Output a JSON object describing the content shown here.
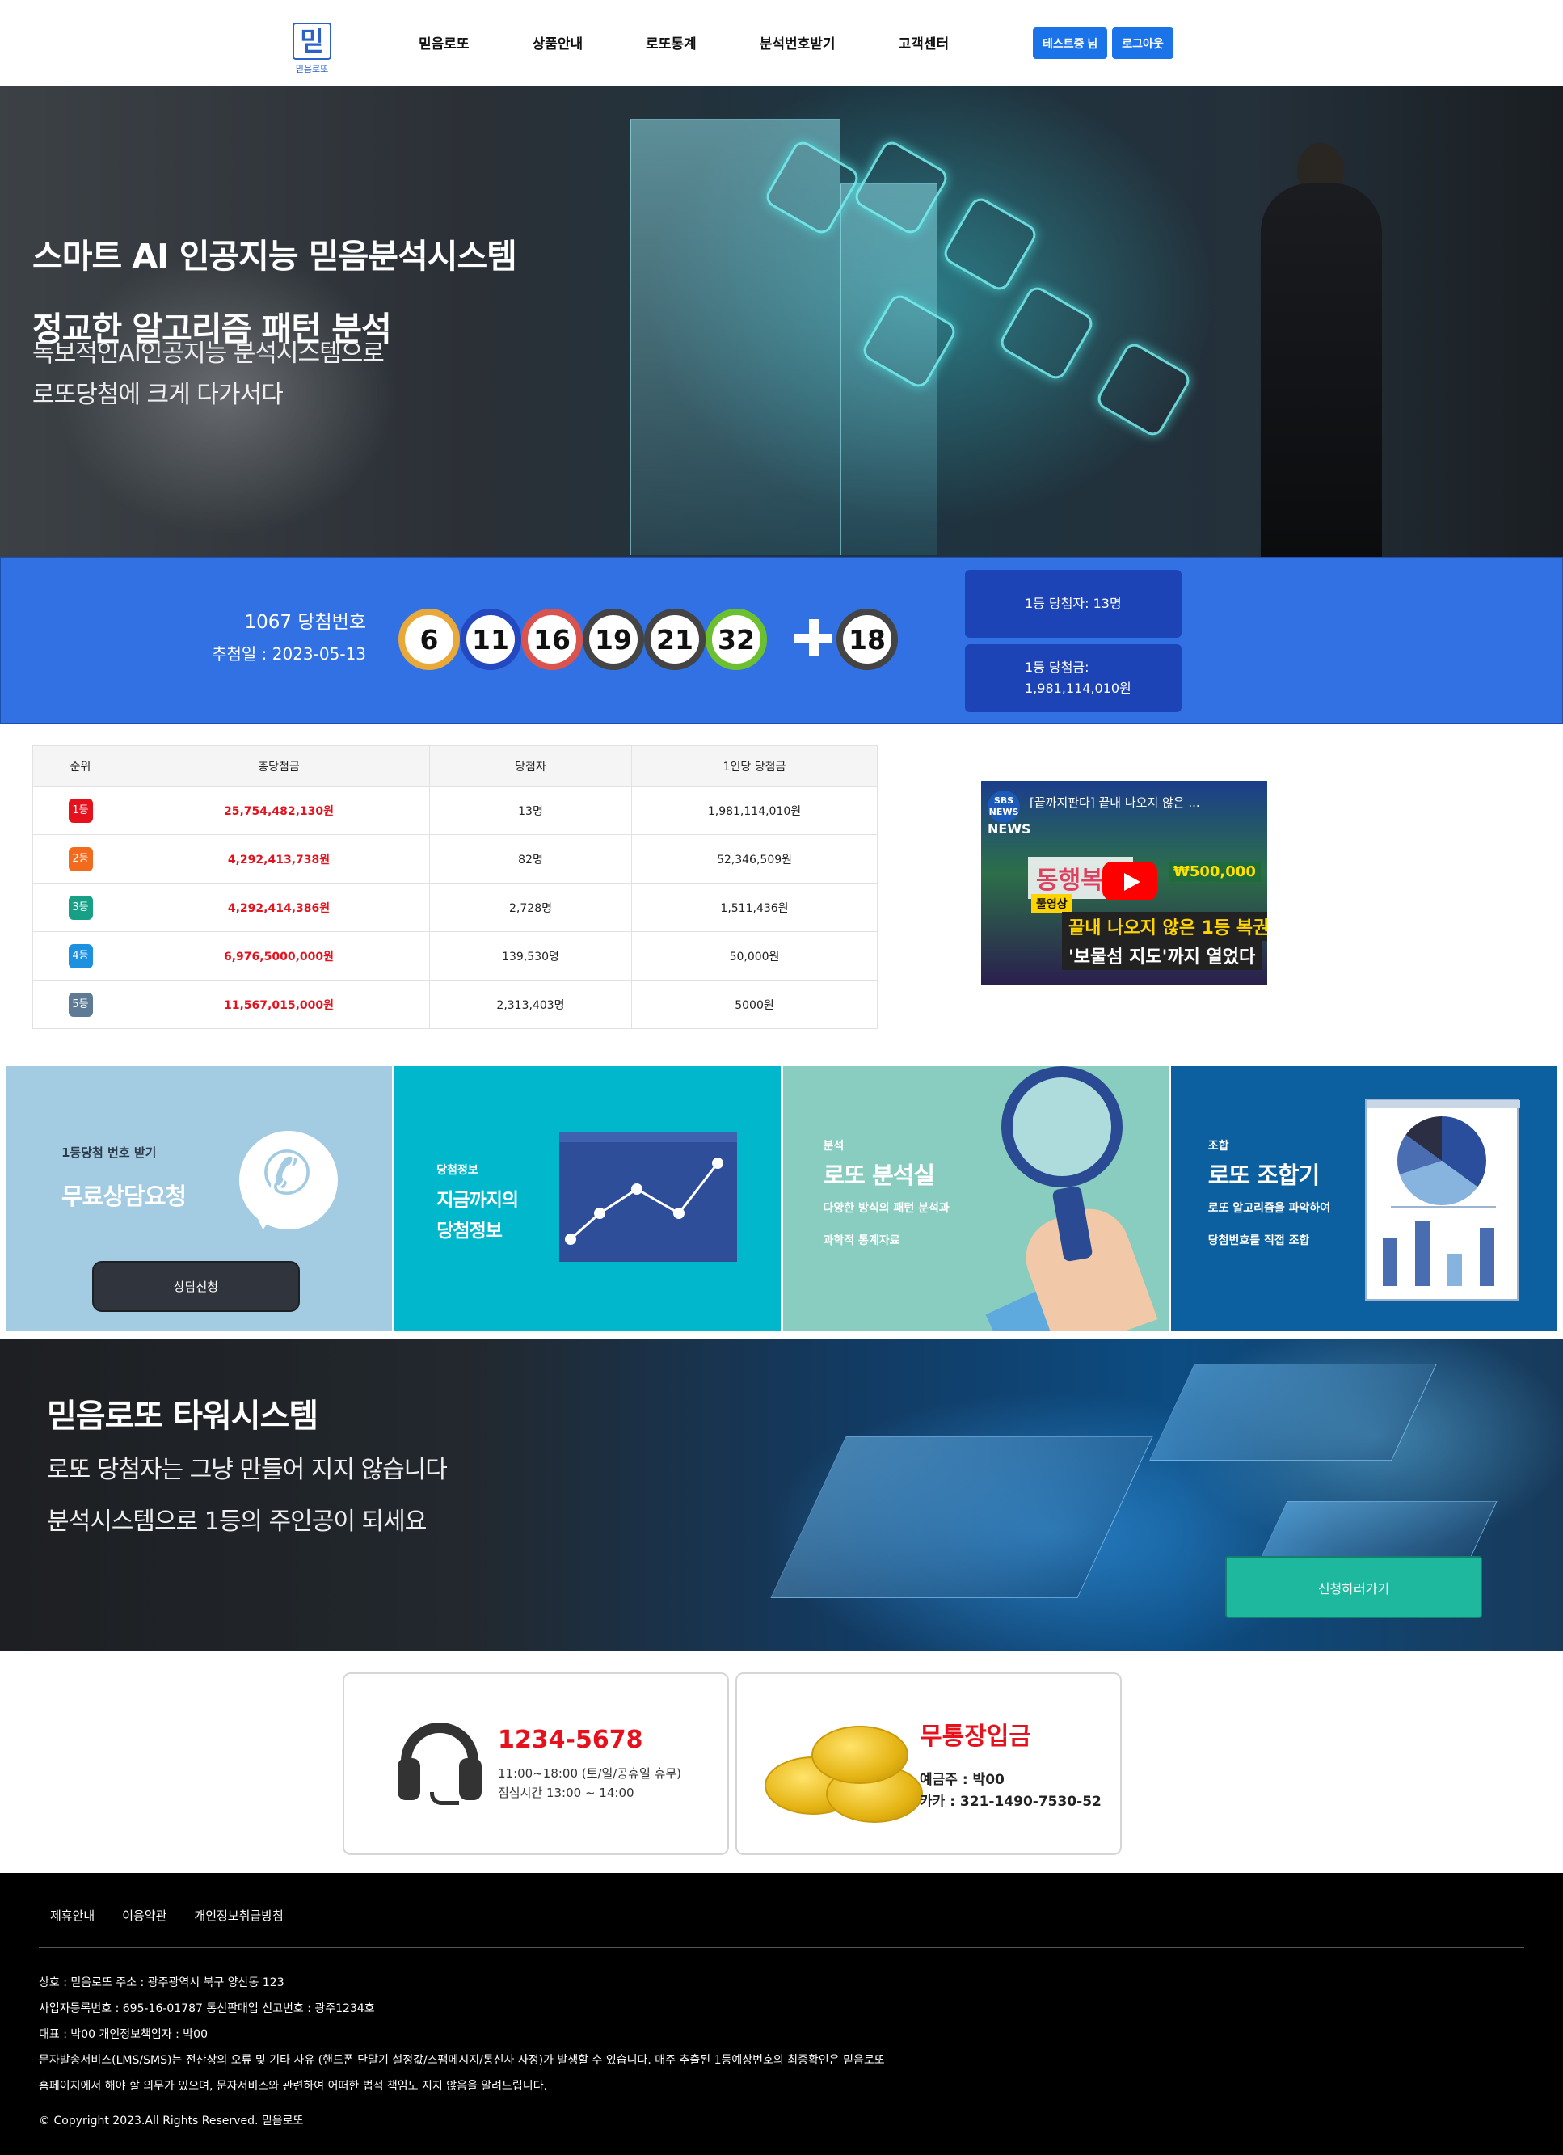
{
  "header": {
    "logo_mark": "믿",
    "logo_text": "믿음로또",
    "nav": [
      "믿음로또",
      "상품안내",
      "로또통계",
      "분석번호받기",
      "고객센터"
    ],
    "user_name_button": "테스트중 님",
    "logout_button": "로그아웃",
    "accent_color": "#1a73e8"
  },
  "hero": {
    "title_line1": "스마트 AI 인공지능 믿음분석시스템",
    "title_line2": "정교한 알고리즘 패턴 분석",
    "sub_line1": "독보적인AI인공지능 분석시스템으로",
    "sub_line2": "로또당첨에 크게 다가서다"
  },
  "draw": {
    "round_label": "1067 당첨번호",
    "date_label": "추첨일 : 2023-05-13",
    "numbers": [
      {
        "value": "6",
        "color": "#e8a93a"
      },
      {
        "value": "11",
        "color": "#2448c0"
      },
      {
        "value": "16",
        "color": "#d9534f"
      },
      {
        "value": "19",
        "color": "#444444"
      },
      {
        "value": "21",
        "color": "#444444"
      },
      {
        "value": "32",
        "color": "#6cbf2e"
      }
    ],
    "bonus": {
      "value": "18",
      "color": "#444444"
    },
    "first_winners": "1등 당첨자: 13명",
    "first_prize_label": "1등 당첨금:",
    "first_prize_value": "1,981,114,010원",
    "bar_color": "#3271e3"
  },
  "prize_table": {
    "headers": [
      "순위",
      "총당첨금",
      "당첨자",
      "1인당 당첨금"
    ],
    "rows": [
      {
        "rank": "1등",
        "color": "#e5121e",
        "total": "25,754,482,130원",
        "winners": "13명",
        "per_person": "1,981,114,010원"
      },
      {
        "rank": "2등",
        "color": "#f26a1b",
        "total": "4,292,413,738원",
        "winners": "82명",
        "per_person": "52,346,509원"
      },
      {
        "rank": "3등",
        "color": "#17a085",
        "total": "4,292,414,386원",
        "winners": "2,728명",
        "per_person": "1,511,436원"
      },
      {
        "rank": "4등",
        "color": "#1e90e0",
        "total": "6,976,5000,000원",
        "winners": "139,530명",
        "per_person": "50,000원"
      },
      {
        "rank": "5등",
        "color": "#5f7a95",
        "total": "11,567,015,000원",
        "winners": "2,313,403명",
        "per_person": "5000원"
      }
    ]
  },
  "video": {
    "channel": "SBS NEWS",
    "news": "NEWS",
    "title": "[끝까지판다] 끝내 나오지 않은 ...",
    "banner": "동행복권",
    "prize": "₩500,000",
    "tag": "풀영상",
    "caption1": "끝내 나오지 않은 1등 복권",
    "caption2": "'보물섬 지도'까지 열었다"
  },
  "cards": [
    {
      "sub": "1등당첨 번호 받기",
      "title": "무료상담요청",
      "button": "상담신청",
      "bg": "#a3cbe1"
    },
    {
      "sub": "당첨정보",
      "title_line1": "지금까지의",
      "title_line2": "당첨정보",
      "bg": "#00b7cc"
    },
    {
      "sub": "분석",
      "title": "로또 분석실",
      "desc1": "다양한 방식의 패턴 분석과",
      "desc2": "과학적 통계자료",
      "bg": "#88cdc0"
    },
    {
      "sub": "조합",
      "title": "로또 조합기",
      "desc1": "로또 알고리즘을 파악하여",
      "desc2": "당첨번호를 직접 조합",
      "bg": "#0c609f"
    }
  ],
  "tower": {
    "title": "믿음로또 타워시스템",
    "sub_line1": "로또 당첨자는 그냥 만들어 지지 않습니다",
    "sub_line2": "분석시스템으로 1등의 주인공이 되세요",
    "button": "신청하러가기"
  },
  "contact": {
    "tel": "1234-5678",
    "hours": "11:00~18:00 (토/일/공휴일 휴무)",
    "lunch": "점심시간 13:00 ~ 14:00",
    "bank_title": "무통장입금",
    "depositor": "예금주 : 박00",
    "account": "카카 : 321-1490-7530-52"
  },
  "footer": {
    "links": [
      "제휴안내",
      "이용약관",
      "개인정보취급방침"
    ],
    "info": [
      "상호 : 믿음로또 주소 : 광주광역시 북구 양산동 123",
      "사업자등록번호 : 695-16-01787 통신판매업 신고번호 : 광주1234호",
      "대표 : 박00 개인정보책임자 : 박00",
      "문자발송서비스(LMS/SMS)는 전산상의 오류 및 기타 사유 (핸드폰 단말기 설정값/스팸메시지/통신사 사정)가 발생할 수 있습니다. 매주 추출된 1등예상번호의 최종확인은 믿음로또",
      "홈페이지에서 해야 할 의무가 있으며, 문자서비스와 관련하여 어떠한 법적 책임도 지지 않음을 알려드립니다."
    ],
    "copyright": "© Copyright 2023.All Rights Reserved. 믿음로또"
  }
}
